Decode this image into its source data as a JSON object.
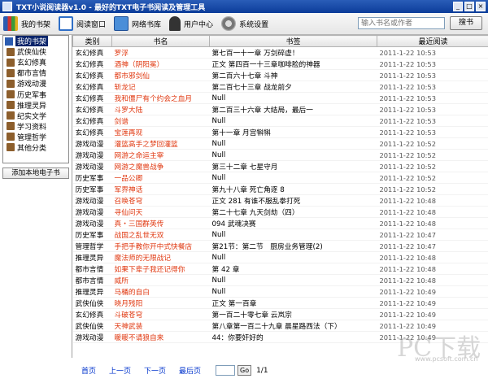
{
  "window": {
    "title": "TXT小说阅读器v1.0 - 最好的TXT电子书阅读及管理工具",
    "min": "_",
    "max": "□",
    "close": "×"
  },
  "toolbar": {
    "items": [
      {
        "label": "我的书架",
        "icon": "bookshelf-icon"
      },
      {
        "label": "阅读窗口",
        "icon": "reader-icon"
      },
      {
        "label": "网络书库",
        "icon": "online-library-icon"
      },
      {
        "label": "用户中心",
        "icon": "user-icon"
      },
      {
        "label": "系统设置",
        "icon": "gear-icon"
      }
    ],
    "search_placeholder": "输入书名或作者",
    "search_button": "搜书"
  },
  "sidebar": {
    "root": "我的书架",
    "categories": [
      "武侠仙侠",
      "玄幻修真",
      "都市言情",
      "游戏动漫",
      "历史军事",
      "推理灵异",
      "纪实文学",
      "学习资料",
      "管理哲学",
      "其他分类"
    ],
    "add_button": "添加本地电子书"
  },
  "table": {
    "headers": [
      "类别",
      "书名",
      "书签",
      "最近阅读"
    ],
    "rows": [
      [
        "玄幻修真",
        "罗浮",
        "第七百一十一章 万剑碎虚！",
        "2011-1-22 10:53"
      ],
      [
        "玄幻修真",
        "酒神（阴阳冕）",
        "正文 第四百一十三章咖啡脸的神器",
        "2011-1-22 10:53"
      ],
      [
        "玄幻修真",
        "都市邪剑仙",
        "第二百六十七章 斗神",
        "2011-1-22 10:53"
      ],
      [
        "玄幻修真",
        "斩龙记",
        "第二百七十三章 战龙前夕",
        "2011-1-22 10:53"
      ],
      [
        "玄幻修真",
        "我和僵尸有个约会之血月",
        "Null",
        "2011-1-22 10:53"
      ],
      [
        "玄幻修真",
        "斗罗大陆",
        "第二百三十六章 大结局，最后一",
        "2011-1-22 10:53"
      ],
      [
        "玄幻修真",
        "剑谱",
        "Null",
        "2011-1-22 10:53"
      ],
      [
        "玄幻修真",
        "宝莲再现",
        "第十一章 月宫犐犐",
        "2011-1-22 10:53"
      ],
      [
        "游戏动漫",
        "灌篮高手之梦回灌篮",
        "Null",
        "2011-1-22 10:52"
      ],
      [
        "游戏动漫",
        "网游之命运主宰",
        "Null",
        "2011-1-22 10:52"
      ],
      [
        "游戏动漫",
        "网游之魔兽战争",
        "第三十二章 七星守月",
        "2011-1-22 10:52"
      ],
      [
        "历史军事",
        "一品公卿",
        "Null",
        "2011-1-22 10:52"
      ],
      [
        "历史军事",
        "军界神话",
        "第九十八章 死亡角逐 8",
        "2011-1-22 10:52"
      ],
      [
        "游戏动漫",
        "召唤苍穹",
        "正文 281 有谁不服乱拳打死",
        "2011-1-22 10:48"
      ],
      [
        "游戏动漫",
        "寻仙问天",
        "第二十七章 九天剑劫（四）",
        "2011-1-22 10:48"
      ],
      [
        "游戏动漫",
        "真・三国群英传",
        "094 武魂决赛",
        "2011-1-22 10:48"
      ],
      [
        "历史军事",
        "战国之乱世无双",
        "Null",
        "2011-1-22 10:47"
      ],
      [
        "管理哲学",
        "手把手教你开中式快餐店",
        "第21节：第二节　厨房业务管理(2)",
        "2011-1-22 10:47"
      ],
      [
        "推理灵异",
        "魔法师的无限战记",
        "Null",
        "2011-1-22 10:48"
      ],
      [
        "都市言情",
        "如果下辈子我还记得你",
        "第 42 章",
        "2011-1-22 10:48"
      ],
      [
        "都市言情",
        "威所",
        "Null",
        "2011-1-22 10:48"
      ],
      [
        "推理灵异",
        "马桶的自白",
        "Null",
        "2011-1-22 10:49"
      ],
      [
        "武侠仙侠",
        "晓月残阳",
        "正文 第一百章",
        "2011-1-22 10:49"
      ],
      [
        "玄幻修真",
        "斗破苍穹",
        "第一百二十零七章 云岚宗",
        "2011-1-22 10:49"
      ],
      [
        "武侠仙侠",
        "天神武装",
        "第八章第一百二十九章 晨星路西法（下）",
        "2011-1-22 10:49"
      ],
      [
        "游戏动漫",
        "暖暖不请狼自来",
        "44：你要奸好的",
        "2011-1-22 10:49"
      ]
    ]
  },
  "pager": {
    "first": "首页",
    "prev": "上一页",
    "next": "下一页",
    "last": "最后页",
    "go": "Go",
    "info": "1/1"
  },
  "watermark": {
    "text": "PC下载",
    "url": "www.pcsoft.com.cn"
  }
}
